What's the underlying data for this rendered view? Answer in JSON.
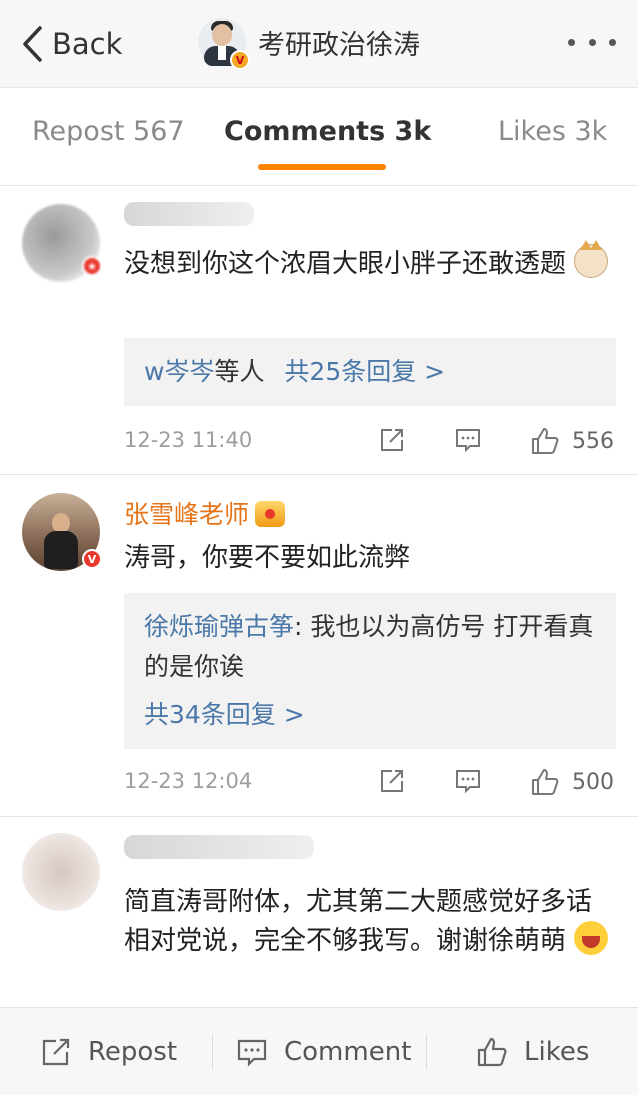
{
  "header": {
    "back_label": "Back",
    "title": "考研政治徐涛",
    "badge": "V"
  },
  "tabs": [
    {
      "label": "Repost 567",
      "active": false
    },
    {
      "label": "Comments 3k",
      "active": true
    },
    {
      "label": "Likes 3k",
      "active": false
    }
  ],
  "comments": [
    {
      "name": "",
      "text": "没想到你这个浓眉大眼小胖子还敢透题",
      "reply_summary": {
        "users": "w岑岑",
        "suffix": "等人",
        "link": "共25条回复 >"
      },
      "time": "12-23 11:40",
      "likes": "556"
    },
    {
      "name": "张雪峰老师",
      "text": "涛哥，你要不要如此流弊",
      "reply": {
        "user": "徐烁瑜弹古筝",
        "text": ": 我也以为高仿号 打开看真的是你诶"
      },
      "reply_link": "共34条回复 >",
      "time": "12-23 12:04",
      "likes": "500"
    },
    {
      "name": "",
      "text": "简直涛哥附体，尤其第二大题感觉好多话相对党说，完全不够我写。谢谢徐萌萌"
    }
  ],
  "bottom_bar": {
    "repost": "Repost",
    "comment": "Comment",
    "likes": "Likes"
  },
  "colors": {
    "accent": "#ff8200",
    "link": "#4a78a8",
    "name_highlight": "#e6751a"
  }
}
